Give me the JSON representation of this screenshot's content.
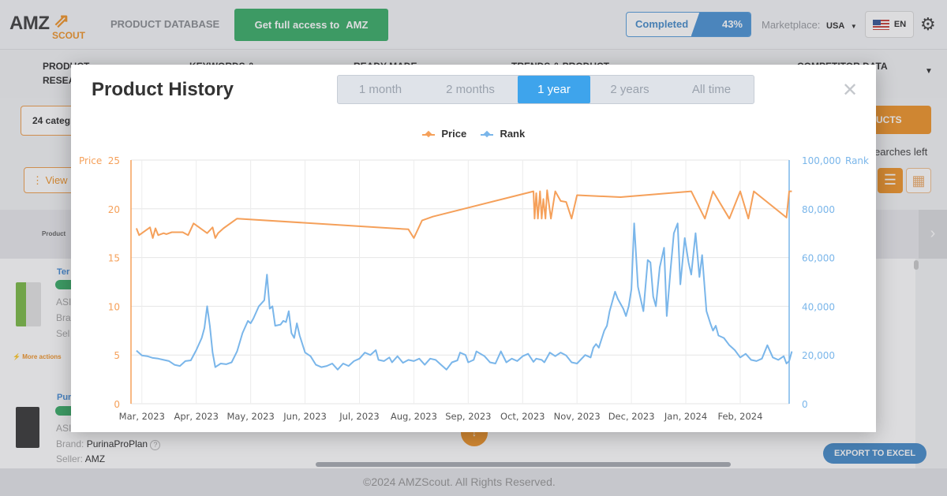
{
  "header": {
    "logo_text": "AMZ",
    "logo_sub": "SCOUT",
    "section_title": "PRODUCT DATABASE",
    "access_button": "Get full access to",
    "access_button_logo": "AMZ",
    "progress_label": "Completed",
    "progress_percent": "43%",
    "progress_value": 0.43,
    "marketplace_label": "Marketplace:",
    "marketplace_value": "USA",
    "language": "EN",
    "icons": {
      "settings": "gear-icon",
      "flag": "us-flag-icon",
      "dropdown": "caret-down-icon"
    }
  },
  "nav": {
    "items": [
      {
        "line1": "PRODUCT",
        "line2": "RESEA"
      },
      {
        "line1": "KEYWORDS &",
        "line2": ""
      },
      {
        "line1": "READY MADE",
        "line2": ""
      },
      {
        "line1": "TRENDS & PRODUCT",
        "line2": ""
      },
      {
        "line1": "COMPETITOR DATA",
        "line2": ""
      }
    ]
  },
  "filters": {
    "categories_label": "24  categ",
    "view_button": "View",
    "products_button": "UCTS",
    "searches_left": "earches left"
  },
  "table": {
    "column_product": "Product",
    "rows": [
      {
        "name": "Ter",
        "badge": "Ne",
        "asin_label": "ASI",
        "brand_label": "Bra",
        "seller_label": "Sel"
      },
      {
        "name": "Pur",
        "badge": "Ne",
        "asin_label": "ASI",
        "brand_label": "Brand:",
        "brand_value": "PurinaProPlan",
        "seller_label": "Seller:",
        "seller_value": "AMZ"
      }
    ],
    "more_actions": "More actions"
  },
  "export_button": "EXPORT TO EXCEL",
  "footer": "©2024 AMZScout. All Rights Reserved.",
  "modal": {
    "title": "Product History",
    "close_icon": "close-icon",
    "range_tabs": [
      {
        "label": "1 month",
        "active": false
      },
      {
        "label": "2 months",
        "active": false
      },
      {
        "label": "1 year",
        "active": true
      },
      {
        "label": "2 years",
        "active": false
      },
      {
        "label": "All time",
        "active": false
      }
    ]
  },
  "colors": {
    "price": "#f5a05a",
    "rank": "#7ab6ea",
    "accent": "#f0962e",
    "active_tab": "#3ea4ec",
    "green": "#3daf6b"
  },
  "chart_data": {
    "type": "line",
    "title": "",
    "legend": [
      "Price",
      "Rank"
    ],
    "legend_position": "top-center",
    "x_ticks": [
      "Mar, 2023",
      "Apr, 2023",
      "May, 2023",
      "Jun, 2023",
      "Jul, 2023",
      "Aug, 2023",
      "Sep, 2023",
      "Oct, 2023",
      "Nov, 2023",
      "Dec, 2023",
      "Jan, 2024",
      "Feb, 2024"
    ],
    "x_range_months": [
      -0.2,
      11.9
    ],
    "y_left": {
      "label": "Price",
      "range": [
        0,
        25
      ],
      "ticks": [
        0,
        5,
        10,
        15,
        20,
        25
      ]
    },
    "y_right": {
      "label": "Rank",
      "range": [
        0,
        100000
      ],
      "ticks": [
        "0",
        "20,000",
        "40,000",
        "60,000",
        "80,000",
        "100,000"
      ]
    },
    "grid": true,
    "series": [
      {
        "name": "Price",
        "axis": "left",
        "points": [
          [
            -0.1,
            18.0
          ],
          [
            -0.05,
            17.3
          ],
          [
            0.15,
            18.1
          ],
          [
            0.2,
            17.0
          ],
          [
            0.25,
            18.0
          ],
          [
            0.3,
            17.3
          ],
          [
            0.4,
            17.5
          ],
          [
            0.45,
            17.4
          ],
          [
            0.55,
            17.6
          ],
          [
            0.75,
            17.6
          ],
          [
            0.85,
            17.3
          ],
          [
            0.95,
            18.5
          ],
          [
            1.2,
            17.5
          ],
          [
            1.3,
            18.1
          ],
          [
            1.35,
            17.0
          ],
          [
            1.4,
            17.5
          ],
          [
            1.5,
            18.0
          ],
          [
            1.75,
            19.0
          ],
          [
            4.9,
            17.9
          ],
          [
            5.0,
            17.0
          ],
          [
            5.15,
            18.8
          ],
          [
            5.35,
            19.2
          ],
          [
            7.2,
            21.8
          ],
          [
            7.22,
            19.0
          ],
          [
            7.25,
            21.6
          ],
          [
            7.28,
            19.0
          ],
          [
            7.32,
            21.8
          ],
          [
            7.35,
            19.0
          ],
          [
            7.38,
            21.0
          ],
          [
            7.42,
            19.0
          ],
          [
            7.45,
            21.9
          ],
          [
            7.52,
            19.0
          ],
          [
            7.6,
            21.8
          ],
          [
            7.7,
            20.8
          ],
          [
            7.8,
            20.7
          ],
          [
            7.9,
            19.0
          ],
          [
            8.0,
            21.4
          ],
          [
            8.8,
            21.2
          ],
          [
            10.1,
            21.8
          ],
          [
            10.35,
            19.0
          ],
          [
            10.5,
            21.8
          ],
          [
            10.8,
            19.0
          ],
          [
            11.0,
            21.8
          ],
          [
            11.15,
            19.0
          ],
          [
            11.25,
            21.8
          ],
          [
            11.85,
            19.1
          ],
          [
            11.9,
            21.8
          ],
          [
            11.95,
            21.8
          ]
        ]
      },
      {
        "name": "Rank",
        "axis": "right",
        "points": [
          [
            -0.1,
            21800
          ],
          [
            0.0,
            19800
          ],
          [
            0.1,
            19500
          ],
          [
            0.2,
            18800
          ],
          [
            0.3,
            18500
          ],
          [
            0.4,
            18000
          ],
          [
            0.5,
            17500
          ],
          [
            0.6,
            16000
          ],
          [
            0.7,
            15500
          ],
          [
            0.8,
            17500
          ],
          [
            0.9,
            17800
          ],
          [
            1.0,
            22000
          ],
          [
            1.1,
            27000
          ],
          [
            1.15,
            31000
          ],
          [
            1.2,
            40000
          ],
          [
            1.25,
            32000
          ],
          [
            1.3,
            21000
          ],
          [
            1.35,
            15000
          ],
          [
            1.45,
            16500
          ],
          [
            1.55,
            16200
          ],
          [
            1.65,
            17000
          ],
          [
            1.75,
            21500
          ],
          [
            1.85,
            29000
          ],
          [
            1.95,
            34000
          ],
          [
            2.0,
            33000
          ],
          [
            2.05,
            35000
          ],
          [
            2.15,
            40000
          ],
          [
            2.25,
            42500
          ],
          [
            2.3,
            53000
          ],
          [
            2.35,
            39000
          ],
          [
            2.4,
            40000
          ],
          [
            2.45,
            32000
          ],
          [
            2.55,
            32500
          ],
          [
            2.6,
            34000
          ],
          [
            2.65,
            33500
          ],
          [
            2.7,
            38000
          ],
          [
            2.75,
            29000
          ],
          [
            2.8,
            27000
          ],
          [
            2.85,
            33000
          ],
          [
            2.9,
            28000
          ],
          [
            3.0,
            21000
          ],
          [
            3.1,
            19500
          ],
          [
            3.2,
            16000
          ],
          [
            3.3,
            15000
          ],
          [
            3.4,
            15500
          ],
          [
            3.5,
            16500
          ],
          [
            3.6,
            14000
          ],
          [
            3.7,
            16500
          ],
          [
            3.8,
            15500
          ],
          [
            3.9,
            17500
          ],
          [
            4.0,
            18500
          ],
          [
            4.1,
            21000
          ],
          [
            4.2,
            20000
          ],
          [
            4.3,
            22000
          ],
          [
            4.35,
            18000
          ],
          [
            4.45,
            17500
          ],
          [
            4.55,
            19000
          ],
          [
            4.6,
            17000
          ],
          [
            4.7,
            19500
          ],
          [
            4.8,
            16800
          ],
          [
            4.9,
            18000
          ],
          [
            5.0,
            17500
          ],
          [
            5.1,
            18500
          ],
          [
            5.2,
            16000
          ],
          [
            5.3,
            18500
          ],
          [
            5.4,
            18000
          ],
          [
            5.5,
            16000
          ],
          [
            5.6,
            14000
          ],
          [
            5.7,
            17000
          ],
          [
            5.8,
            17800
          ],
          [
            5.85,
            21000
          ],
          [
            5.95,
            20000
          ],
          [
            6.0,
            17000
          ],
          [
            6.1,
            18000
          ],
          [
            6.15,
            21500
          ],
          [
            6.3,
            19500
          ],
          [
            6.4,
            17000
          ],
          [
            6.5,
            16500
          ],
          [
            6.6,
            21500
          ],
          [
            6.7,
            17000
          ],
          [
            6.8,
            18500
          ],
          [
            6.9,
            17500
          ],
          [
            7.0,
            19500
          ],
          [
            7.1,
            20500
          ],
          [
            7.2,
            17200
          ],
          [
            7.25,
            18500
          ],
          [
            7.35,
            18000
          ],
          [
            7.4,
            17000
          ],
          [
            7.5,
            21000
          ],
          [
            7.6,
            19500
          ],
          [
            7.7,
            21000
          ],
          [
            7.8,
            19800
          ],
          [
            7.9,
            17000
          ],
          [
            8.0,
            16500
          ],
          [
            8.15,
            20000
          ],
          [
            8.25,
            19000
          ],
          [
            8.3,
            23000
          ],
          [
            8.35,
            24500
          ],
          [
            8.4,
            23000
          ],
          [
            8.5,
            30000
          ],
          [
            8.55,
            32000
          ],
          [
            8.6,
            38000
          ],
          [
            8.7,
            46000
          ],
          [
            8.75,
            43000
          ],
          [
            8.85,
            39000
          ],
          [
            8.9,
            36000
          ],
          [
            8.95,
            40000
          ],
          [
            9.0,
            47000
          ],
          [
            9.05,
            74000
          ],
          [
            9.12,
            48000
          ],
          [
            9.18,
            42000
          ],
          [
            9.22,
            38000
          ],
          [
            9.3,
            59000
          ],
          [
            9.35,
            58000
          ],
          [
            9.4,
            44000
          ],
          [
            9.45,
            40000
          ],
          [
            9.52,
            56000
          ],
          [
            9.6,
            64000
          ],
          [
            9.65,
            36000
          ],
          [
            9.72,
            55000
          ],
          [
            9.78,
            70000
          ],
          [
            9.85,
            74000
          ],
          [
            9.9,
            49000
          ],
          [
            9.98,
            68000
          ],
          [
            10.05,
            58000
          ],
          [
            10.1,
            53000
          ],
          [
            10.18,
            70000
          ],
          [
            10.25,
            52000
          ],
          [
            10.3,
            61000
          ],
          [
            10.38,
            38000
          ],
          [
            10.45,
            33000
          ],
          [
            10.5,
            30000
          ],
          [
            10.55,
            32000
          ],
          [
            10.6,
            28000
          ],
          [
            10.7,
            27000
          ],
          [
            10.8,
            24000
          ],
          [
            10.9,
            22000
          ],
          [
            11.0,
            19000
          ],
          [
            11.1,
            20500
          ],
          [
            11.2,
            18000
          ],
          [
            11.3,
            17500
          ],
          [
            11.4,
            18500
          ],
          [
            11.5,
            24000
          ],
          [
            11.6,
            19000
          ],
          [
            11.7,
            18000
          ],
          [
            11.8,
            19500
          ],
          [
            11.85,
            16500
          ],
          [
            11.9,
            17500
          ],
          [
            11.95,
            21500
          ]
        ]
      }
    ]
  }
}
